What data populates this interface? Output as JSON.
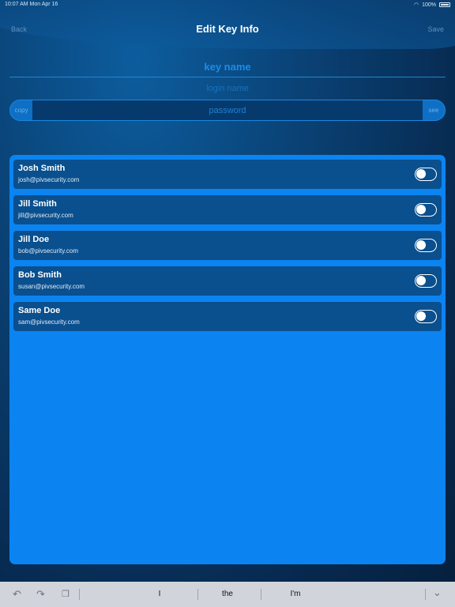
{
  "status_bar": {
    "time_date": "10:07 AM   Mon Apr 16",
    "battery_text": "100%",
    "wifi_icon": "wifi-icon",
    "battery_icon": "battery-icon"
  },
  "nav": {
    "back_label": "Back",
    "title": "Edit Key Info",
    "save_label": "Save"
  },
  "form": {
    "key_name_placeholder": "key name",
    "login_name_placeholder": "login name",
    "password_placeholder": "password",
    "copy_label": "copy",
    "see_label": "see"
  },
  "users": [
    {
      "name": "Josh Smith",
      "email": "josh@pivsecurity.com",
      "enabled": false
    },
    {
      "name": "Jill Smith",
      "email": "jill@pivsecurity.com",
      "enabled": false
    },
    {
      "name": "Jill Doe",
      "email": "bob@pivsecurity.com",
      "enabled": false
    },
    {
      "name": "Bob Smith",
      "email": "susan@pivsecurity.com",
      "enabled": false
    },
    {
      "name": "Same Doe",
      "email": "sam@pivsecurity.com",
      "enabled": false
    }
  ],
  "keyboard": {
    "suggestions": [
      "I",
      "the",
      "I'm"
    ],
    "undo_icon": "undo-icon",
    "redo_icon": "redo-icon",
    "paste_icon": "paste-icon",
    "dismiss_icon": "chevron-down-icon"
  },
  "colors": {
    "accent": "#0b84f1",
    "row_bg": "#0a4f8e",
    "field_text": "#1b8ce8"
  }
}
